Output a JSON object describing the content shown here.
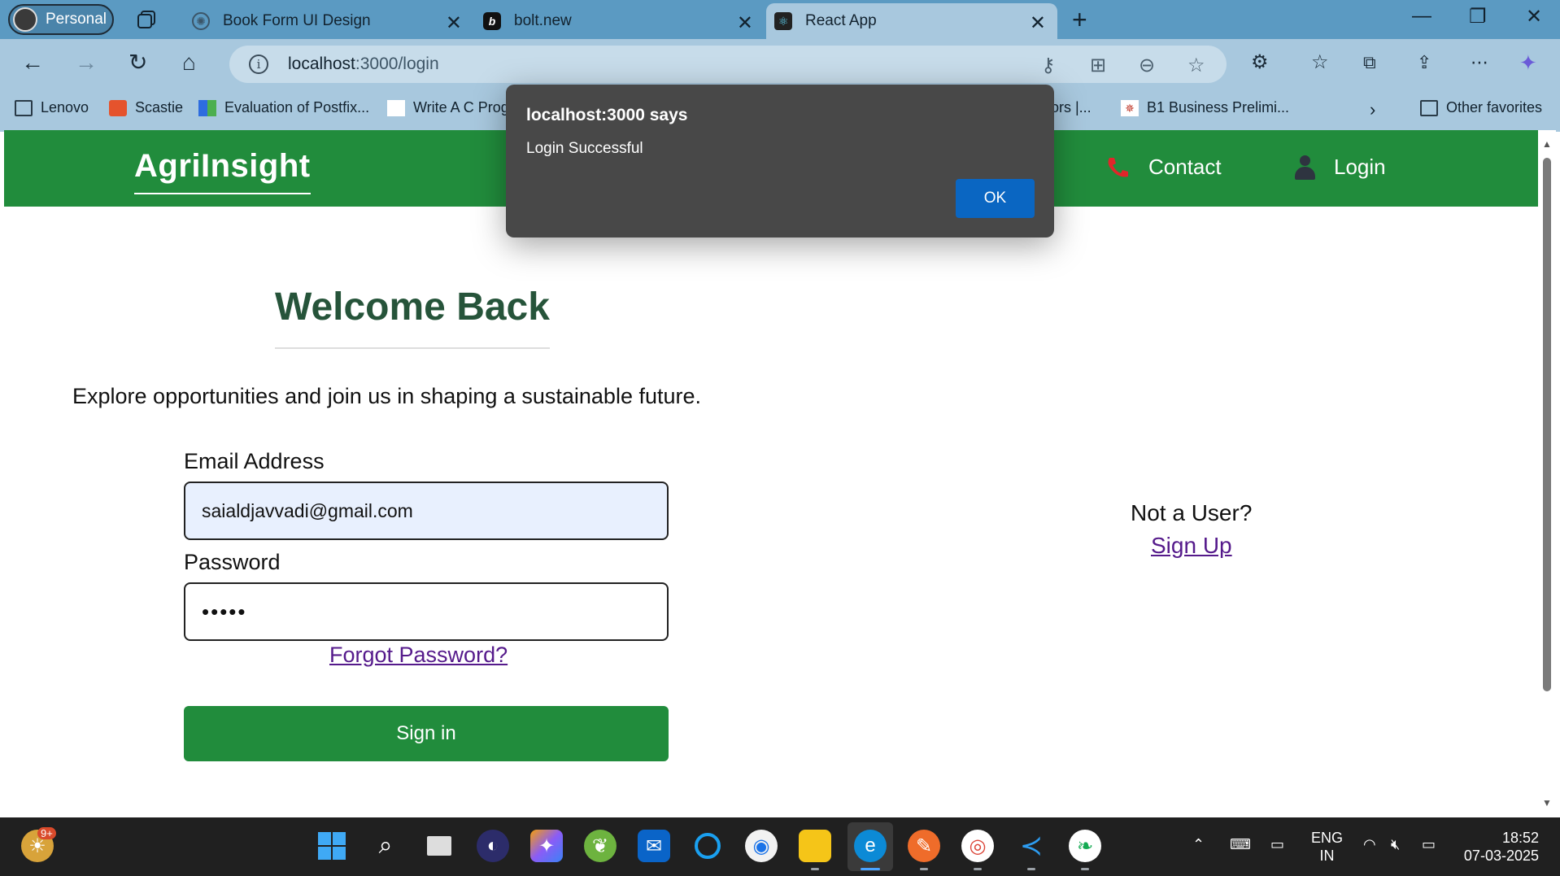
{
  "browser": {
    "profile_label": "Personal",
    "tabs": [
      {
        "title": "Book Form UI Design",
        "favicon": "openai-icon"
      },
      {
        "title": "bolt.new",
        "favicon": "bolt-icon"
      },
      {
        "title": "React App",
        "favicon": "react-icon"
      }
    ],
    "url_host": "localhost",
    "url_path": ":3000/login",
    "favorites": [
      {
        "label": "Lenovo"
      },
      {
        "label": "Scastie"
      },
      {
        "label": "Evaluation of Postfix..."
      },
      {
        "label": "Write A C Prog"
      },
      {
        "label": "ors |..."
      },
      {
        "label": "B1 Business Prelimi..."
      }
    ],
    "other_favorites": "Other favorites"
  },
  "app": {
    "brand": "AgriInsight",
    "nav": {
      "contact": "Contact",
      "login": "Login"
    },
    "welcome_title": "Welcome Back",
    "tagline": "Explore opportunities and join us in shaping a sustainable future.",
    "email_label": "Email Address",
    "email_value": "saialdjavvadi@gmail.com",
    "password_label": "Password",
    "password_value": "•••••",
    "forgot": "Forgot Password?",
    "signin": "Sign in",
    "not_user": "Not a User?",
    "signup": "Sign Up"
  },
  "dialog": {
    "title": "localhost:3000 says",
    "message": "Login Successful",
    "ok": "OK"
  },
  "taskbar": {
    "notification_badge": "9+",
    "lang_top": "ENG",
    "lang_bottom": "IN",
    "time": "18:52",
    "date": "07-03-2025"
  },
  "colors": {
    "brand_green": "#218c3c",
    "heading_green": "#26543a",
    "link_purple": "#551a8b",
    "dialog_bg": "#484848",
    "ok_blue": "#0a66c2"
  }
}
